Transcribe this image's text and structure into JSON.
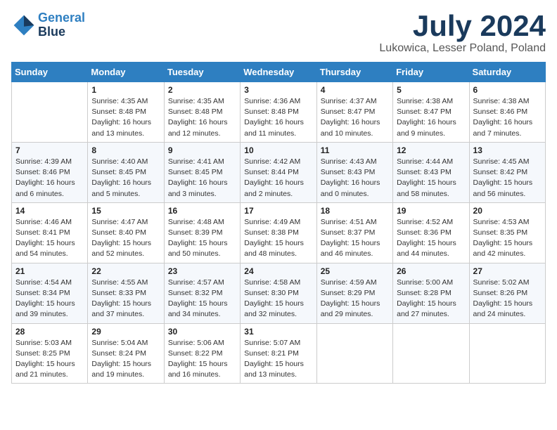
{
  "header": {
    "logo_line1": "General",
    "logo_line2": "Blue",
    "month_title": "July 2024",
    "location": "Lukowica, Lesser Poland, Poland"
  },
  "weekdays": [
    "Sunday",
    "Monday",
    "Tuesday",
    "Wednesday",
    "Thursday",
    "Friday",
    "Saturday"
  ],
  "weeks": [
    [
      {
        "day": "",
        "info": ""
      },
      {
        "day": "1",
        "info": "Sunrise: 4:35 AM\nSunset: 8:48 PM\nDaylight: 16 hours\nand 13 minutes."
      },
      {
        "day": "2",
        "info": "Sunrise: 4:35 AM\nSunset: 8:48 PM\nDaylight: 16 hours\nand 12 minutes."
      },
      {
        "day": "3",
        "info": "Sunrise: 4:36 AM\nSunset: 8:48 PM\nDaylight: 16 hours\nand 11 minutes."
      },
      {
        "day": "4",
        "info": "Sunrise: 4:37 AM\nSunset: 8:47 PM\nDaylight: 16 hours\nand 10 minutes."
      },
      {
        "day": "5",
        "info": "Sunrise: 4:38 AM\nSunset: 8:47 PM\nDaylight: 16 hours\nand 9 minutes."
      },
      {
        "day": "6",
        "info": "Sunrise: 4:38 AM\nSunset: 8:46 PM\nDaylight: 16 hours\nand 7 minutes."
      }
    ],
    [
      {
        "day": "7",
        "info": "Sunrise: 4:39 AM\nSunset: 8:46 PM\nDaylight: 16 hours\nand 6 minutes."
      },
      {
        "day": "8",
        "info": "Sunrise: 4:40 AM\nSunset: 8:45 PM\nDaylight: 16 hours\nand 5 minutes."
      },
      {
        "day": "9",
        "info": "Sunrise: 4:41 AM\nSunset: 8:45 PM\nDaylight: 16 hours\nand 3 minutes."
      },
      {
        "day": "10",
        "info": "Sunrise: 4:42 AM\nSunset: 8:44 PM\nDaylight: 16 hours\nand 2 minutes."
      },
      {
        "day": "11",
        "info": "Sunrise: 4:43 AM\nSunset: 8:43 PM\nDaylight: 16 hours\nand 0 minutes."
      },
      {
        "day": "12",
        "info": "Sunrise: 4:44 AM\nSunset: 8:43 PM\nDaylight: 15 hours\nand 58 minutes."
      },
      {
        "day": "13",
        "info": "Sunrise: 4:45 AM\nSunset: 8:42 PM\nDaylight: 15 hours\nand 56 minutes."
      }
    ],
    [
      {
        "day": "14",
        "info": "Sunrise: 4:46 AM\nSunset: 8:41 PM\nDaylight: 15 hours\nand 54 minutes."
      },
      {
        "day": "15",
        "info": "Sunrise: 4:47 AM\nSunset: 8:40 PM\nDaylight: 15 hours\nand 52 minutes."
      },
      {
        "day": "16",
        "info": "Sunrise: 4:48 AM\nSunset: 8:39 PM\nDaylight: 15 hours\nand 50 minutes."
      },
      {
        "day": "17",
        "info": "Sunrise: 4:49 AM\nSunset: 8:38 PM\nDaylight: 15 hours\nand 48 minutes."
      },
      {
        "day": "18",
        "info": "Sunrise: 4:51 AM\nSunset: 8:37 PM\nDaylight: 15 hours\nand 46 minutes."
      },
      {
        "day": "19",
        "info": "Sunrise: 4:52 AM\nSunset: 8:36 PM\nDaylight: 15 hours\nand 44 minutes."
      },
      {
        "day": "20",
        "info": "Sunrise: 4:53 AM\nSunset: 8:35 PM\nDaylight: 15 hours\nand 42 minutes."
      }
    ],
    [
      {
        "day": "21",
        "info": "Sunrise: 4:54 AM\nSunset: 8:34 PM\nDaylight: 15 hours\nand 39 minutes."
      },
      {
        "day": "22",
        "info": "Sunrise: 4:55 AM\nSunset: 8:33 PM\nDaylight: 15 hours\nand 37 minutes."
      },
      {
        "day": "23",
        "info": "Sunrise: 4:57 AM\nSunset: 8:32 PM\nDaylight: 15 hours\nand 34 minutes."
      },
      {
        "day": "24",
        "info": "Sunrise: 4:58 AM\nSunset: 8:30 PM\nDaylight: 15 hours\nand 32 minutes."
      },
      {
        "day": "25",
        "info": "Sunrise: 4:59 AM\nSunset: 8:29 PM\nDaylight: 15 hours\nand 29 minutes."
      },
      {
        "day": "26",
        "info": "Sunrise: 5:00 AM\nSunset: 8:28 PM\nDaylight: 15 hours\nand 27 minutes."
      },
      {
        "day": "27",
        "info": "Sunrise: 5:02 AM\nSunset: 8:26 PM\nDaylight: 15 hours\nand 24 minutes."
      }
    ],
    [
      {
        "day": "28",
        "info": "Sunrise: 5:03 AM\nSunset: 8:25 PM\nDaylight: 15 hours\nand 21 minutes."
      },
      {
        "day": "29",
        "info": "Sunrise: 5:04 AM\nSunset: 8:24 PM\nDaylight: 15 hours\nand 19 minutes."
      },
      {
        "day": "30",
        "info": "Sunrise: 5:06 AM\nSunset: 8:22 PM\nDaylight: 15 hours\nand 16 minutes."
      },
      {
        "day": "31",
        "info": "Sunrise: 5:07 AM\nSunset: 8:21 PM\nDaylight: 15 hours\nand 13 minutes."
      },
      {
        "day": "",
        "info": ""
      },
      {
        "day": "",
        "info": ""
      },
      {
        "day": "",
        "info": ""
      }
    ]
  ]
}
